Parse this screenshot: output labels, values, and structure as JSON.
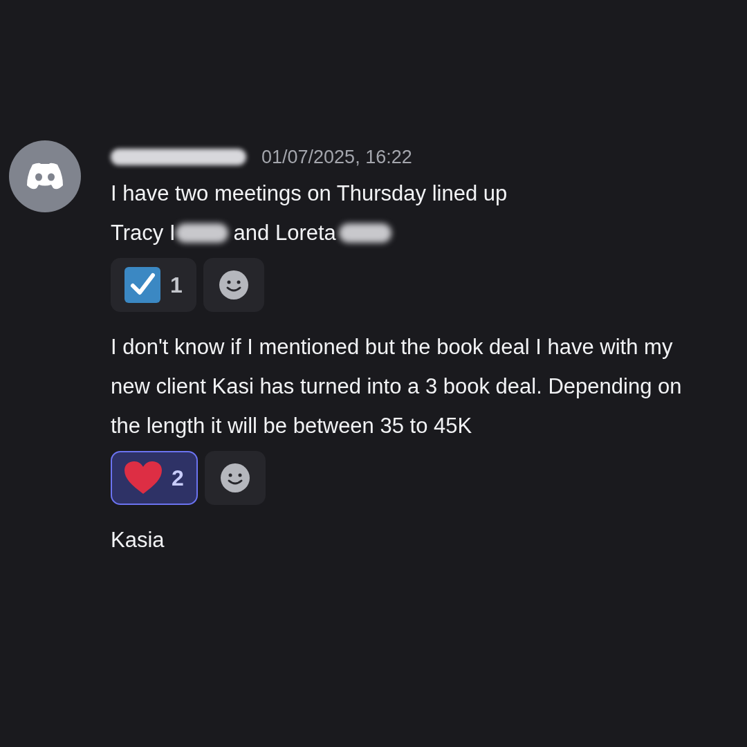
{
  "header": {
    "author_redacted": true,
    "timestamp": "01/07/2025, 16:22"
  },
  "messages": [
    {
      "lines": [
        {
          "parts": [
            {
              "text": "I have two meetings on Thursday lined up",
              "redacted": false
            }
          ]
        },
        {
          "parts": [
            {
              "text": "Tracy I",
              "redacted": true
            },
            {
              "text": "and Loreta",
              "redacted": true
            }
          ]
        }
      ],
      "reactions": [
        {
          "kind": "check",
          "count": "1",
          "selected": false
        }
      ]
    },
    {
      "lines": [
        {
          "parts": [
            {
              "text": "I don't know if I mentioned but the book deal I have with my new client Kasi has turned into a 3 book deal. Depending on the length it will be between 35 to 45K",
              "redacted": false
            }
          ]
        }
      ],
      "reactions": [
        {
          "kind": "heart",
          "count": "2",
          "selected": true
        }
      ]
    },
    {
      "lines": [
        {
          "parts": [
            {
              "text": "Kasia",
              "redacted": false
            }
          ]
        }
      ]
    }
  ]
}
